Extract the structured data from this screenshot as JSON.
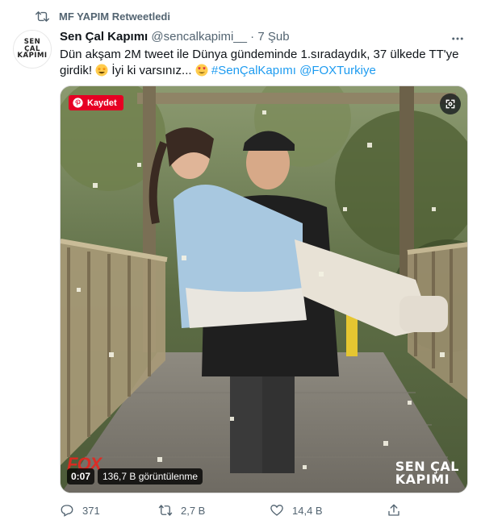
{
  "retweet": {
    "label": "MF YAPIM Retweetledi"
  },
  "avatar": {
    "line1": "SEN",
    "line2": "ÇAL",
    "line3": "KAPIMI"
  },
  "tweet": {
    "author_name": "Sen Çal Kapımı",
    "handle": "@sencalkapimi__",
    "separator": "·",
    "date": "7 Şub",
    "text_part1": "Dün akşam 2M tweet ile Dünya gündeminde 1.sıradaydık, 37 ülkede TT'ye girdik!",
    "text_part2": "İyi ki varsınız...",
    "hashtag": "#SenÇalKapımı",
    "mention": "@FOXTurkiye"
  },
  "media": {
    "pinterest_label": "Kaydet",
    "duration": "0:07",
    "views": "136,7 B görüntülenme",
    "watermark_left": "FOX",
    "show_logo_line1": "SEN ÇAL",
    "show_logo_line2": "KAPIMI"
  },
  "actions": {
    "replies": "371",
    "retweets": "2,7 B",
    "likes": "14,4 B"
  },
  "colors": {
    "accent": "#1d9bf0",
    "muted": "#536471",
    "text": "#0f1419",
    "pinterest": "#e60023"
  }
}
